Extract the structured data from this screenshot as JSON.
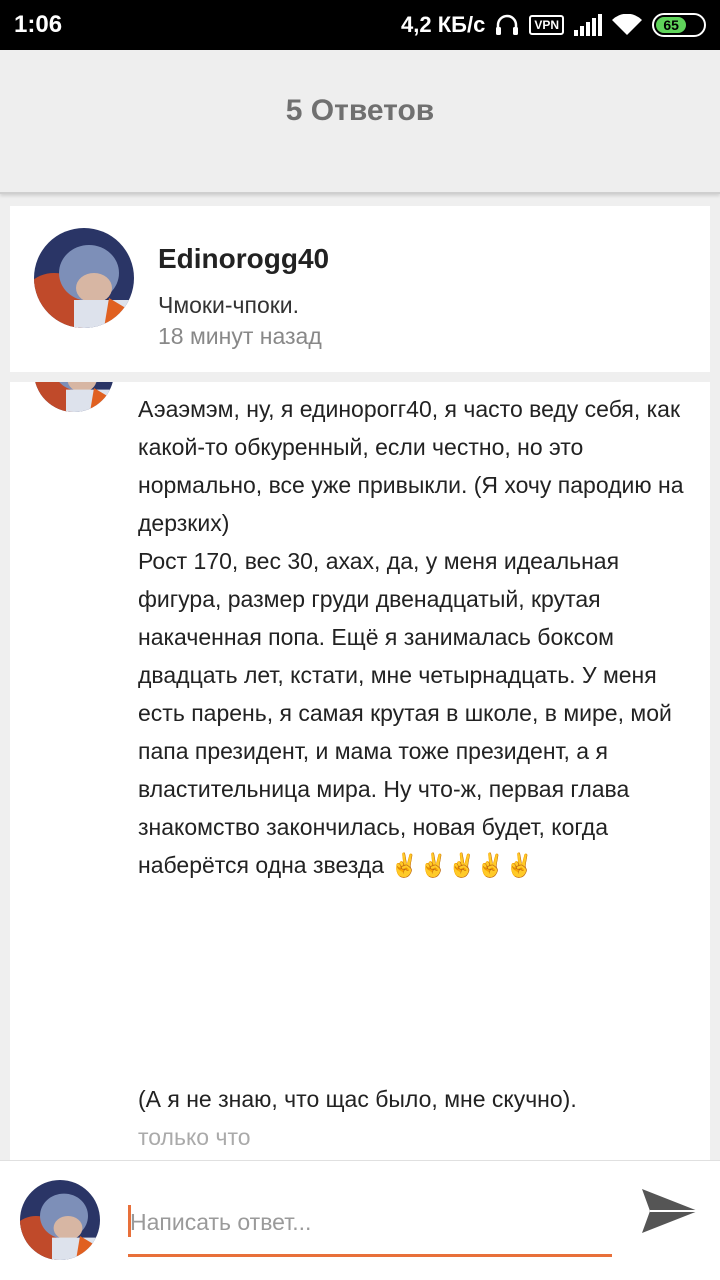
{
  "status_bar": {
    "time": "1:06",
    "speed": "4,2 КБ/с",
    "vpn": "VPN",
    "battery": "65",
    "icons": [
      "headset-icon",
      "vpn-icon",
      "signal-icon",
      "wifi-icon",
      "battery-icon"
    ]
  },
  "header": {
    "title": "5 Ответов"
  },
  "post": {
    "username": "Edinorogg40",
    "message": "Чмоки-чпоки.",
    "time": "18 минут назад"
  },
  "reply": {
    "paragraph1": "Аэаэмэм, ну, я единорогг40, я часто веду себя, как какой-то обкуренный, если честно, но это нормально, все уже привыкли. (Я хочу пародию на дерзких)",
    "paragraph2": "Рост 170, вес 30, ахах, да, у меня идеальная фигура, размер груди двенадцатый, крутая накаченная попа. Ещё я занималась боксом двадцать лет, кстати, мне четырнадцать. У меня есть парень, я самая крутая в школе, в мире, мой папа президент, и мама тоже президент, а я властительница мира. Ну что-ж, первая глава знакомство закончилась, новая будет, когда наберётся одна звезда ✌️✌️✌️✌️✌️",
    "paragraph3": "(А я не знаю, что щас было, мне скучно).",
    "paragraph4": "только что"
  },
  "composer": {
    "placeholder": "Написать ответ..."
  },
  "colors": {
    "accent": "#e8703a",
    "header_bg": "#eeeeee",
    "send_icon": "#555555"
  }
}
